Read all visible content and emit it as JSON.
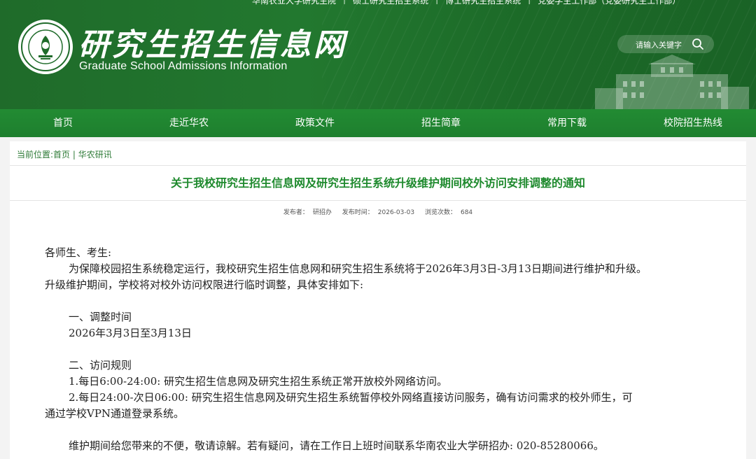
{
  "header": {
    "top_links": [
      "华南农业大学研究生院",
      "硕士研究生招生系统",
      "博士研究生招生系统",
      "党委学生工作部（党委研究生工作部）"
    ],
    "title_cn": "研究生招生信息网",
    "title_en": "Graduate School Admissions Information",
    "search_placeholder": "请输入关键字",
    "logo_icon": "university-seal-logo",
    "building_icon": "campus-building-illustration"
  },
  "nav": {
    "items": [
      "首页",
      "走近华农",
      "政策文件",
      "招生简章",
      "常用下载",
      "校院招生热线"
    ]
  },
  "breadcrumb": {
    "prefix": "当前位置:",
    "home": "首页",
    "sep": "|",
    "current": "华农研讯"
  },
  "article": {
    "title": "关于我校研究生招生信息网及研究生招生系统升级维护期间校外访问安排调整的通知",
    "meta": {
      "publisher_label": "发布者：",
      "publisher": "研招办",
      "time_label": "发布时间：",
      "time": "2026-03-03",
      "views_label": "浏览次数：",
      "views": "684"
    },
    "greeting": "各师生、考生:",
    "para1_line1": "为保障校园招生系统稳定运行，我校研究生招生信息网和研究生招生系统将于2026年3月3日-3月13日期间进行维护和升级。",
    "para1_line2": "升级维护期间，学校将对校外访问权限进行临时调整，具体安排如下:",
    "section1_title": "一、调整时间",
    "section1_body": "2026年3月3日至3月13日",
    "section2_title": "二、访问规则",
    "rule1": "1.每日6:00-24:00: 研究生招生信息网及研究生招生系统正常开放校外网络访问。",
    "rule2_line1": "2.每日24:00-次日06:00: 研究生招生信息网及研究生招生系统暂停校外网络直接访问服务，确有访问需求的校外师生，可",
    "rule2_line2": "通过学校VPN通道登录系统。",
    "closing": "维护期间给您带来的不便，敬请谅解。若有疑问，请在工作日上班时间联系华南农业大学研招办: 020-85280066。"
  },
  "colors": {
    "header_green": "#1f6b2a",
    "nav_green": "#228b33",
    "title_green": "#1f8a2e",
    "breadcrumb_green": "#2d7a36"
  }
}
